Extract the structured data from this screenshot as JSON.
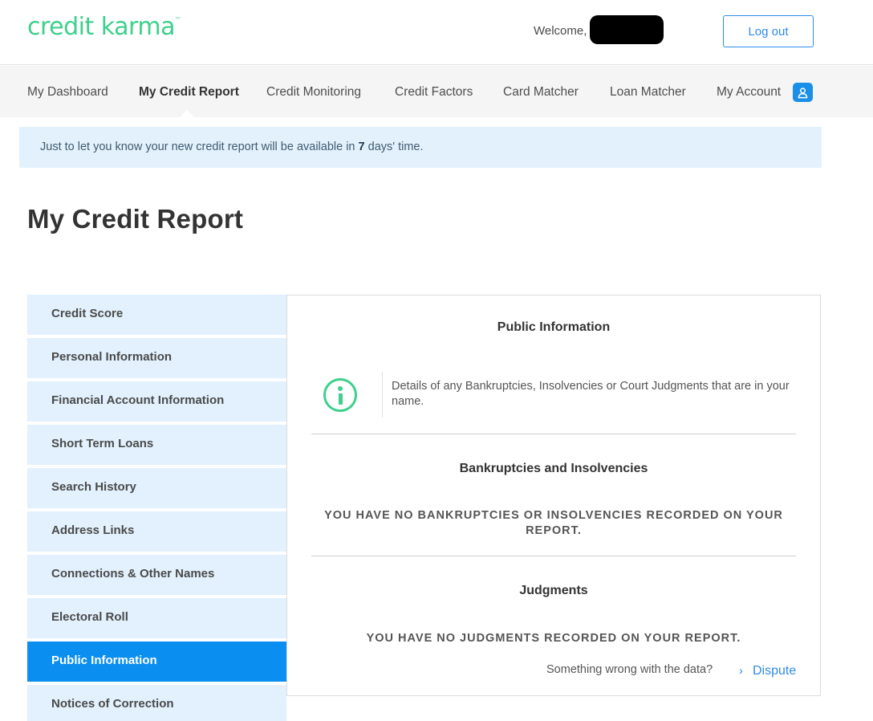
{
  "header": {
    "logo_text": "credit karma",
    "logo_mark": "™",
    "welcome_label": "Welcome,",
    "logout_label": "Log out"
  },
  "nav": {
    "items": [
      {
        "label": "My Dashboard"
      },
      {
        "label": "My Credit Report"
      },
      {
        "label": "Credit Monitoring"
      },
      {
        "label": "Credit Factors"
      },
      {
        "label": "Card Matcher"
      },
      {
        "label": "Loan Matcher"
      },
      {
        "label": "My Account"
      }
    ],
    "active": "My Credit Report",
    "account_icon": "user-icon"
  },
  "banner": {
    "text_before": "Just to let you know your new credit report will be available in ",
    "days": "7",
    "text_after": " days' time."
  },
  "page_title": "My Credit Report",
  "sidebar": {
    "items": [
      {
        "label": "Credit Score"
      },
      {
        "label": "Personal Information"
      },
      {
        "label": "Financial Account Information"
      },
      {
        "label": "Short Term Loans"
      },
      {
        "label": "Search History"
      },
      {
        "label": "Address Links"
      },
      {
        "label": "Connections & Other Names"
      },
      {
        "label": "Electoral Roll"
      },
      {
        "label": "Public Information"
      },
      {
        "label": "Notices of Correction"
      }
    ],
    "active": "Public Information"
  },
  "panel": {
    "title": "Public Information",
    "info_icon": "info-icon",
    "info_text": "Details of any Bankruptcies, Insolvencies or Court Judgments that are in your name.",
    "bankruptcies_title": "Bankruptcies and Insolvencies",
    "bankruptcies_message": "YOU HAVE NO BANKRUPTCIES OR INSOLVENCIES RECORDED ON YOUR REPORT.",
    "judgments_title": "Judgments",
    "judgments_message": "YOU HAVE NO JUDGMENTS RECORDED ON YOUR REPORT.",
    "wrong_data_text": "Something wrong with the data?",
    "dispute_label": "Dispute"
  },
  "colors": {
    "brand_green": "#3ed08c",
    "accent_blue": "#0a8ef0",
    "link_blue": "#2f8be6",
    "banner_bg": "#e3f1fc",
    "sidebar_bg": "#e2f1fd"
  }
}
